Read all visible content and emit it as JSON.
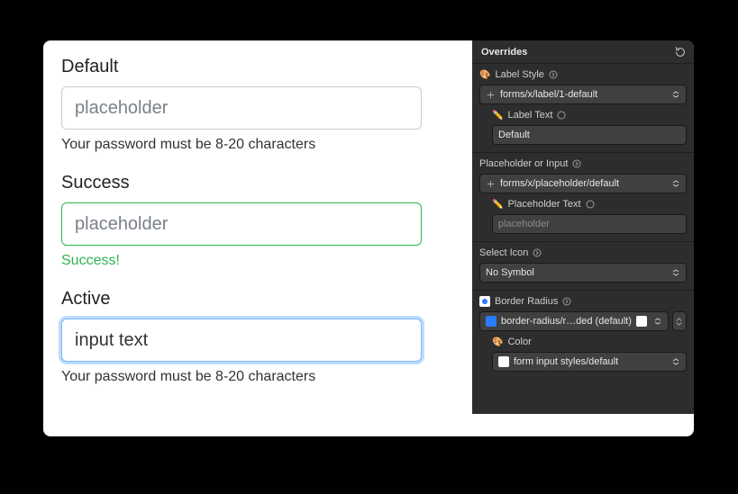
{
  "forms": {
    "default": {
      "label": "Default",
      "placeholder": "placeholder",
      "helper": "Your password must be 8-20 characters"
    },
    "success": {
      "label": "Success",
      "placeholder": "placeholder",
      "helper": "Success!"
    },
    "active": {
      "label": "Active",
      "value": "input text",
      "helper": "Your password must be 8-20 characters"
    }
  },
  "panel": {
    "title": "Overrides",
    "label_style": {
      "title": "Label Style",
      "value": "forms/x/label/1-default",
      "text_title": "Label Text",
      "text_value": "Default"
    },
    "placeholder": {
      "title": "Placeholder or Input",
      "value": "forms/x/placeholder/default",
      "text_title": "Placeholder Text",
      "text_value": "placeholder"
    },
    "select_icon": {
      "title": "Select Icon",
      "value": "No Symbol"
    },
    "border_radius": {
      "title": "Border Radius",
      "value": "border-radius/r…ded (default)",
      "color_title": "Color",
      "color_value": "form input styles/default"
    }
  }
}
